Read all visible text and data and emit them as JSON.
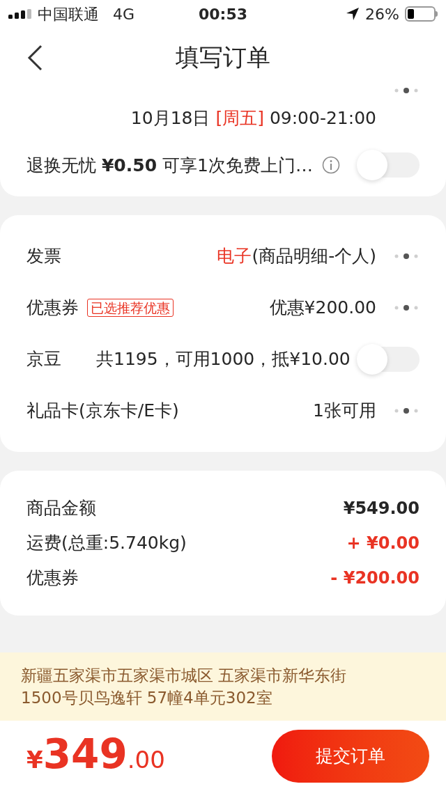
{
  "status_bar": {
    "carrier": "中国联通",
    "network": "4G",
    "time": "00:53",
    "battery": "26%"
  },
  "nav": {
    "title": "填写订单"
  },
  "delivery": {
    "date": "10月18日",
    "weekday": "[周五]",
    "time": "09:00-21:00"
  },
  "return_service": {
    "label": "退换无忧",
    "price": "¥0.50",
    "description": "可享1次免费上门…",
    "on": false
  },
  "options": [
    {
      "kind": "link",
      "label": "发票",
      "value_highlight": "电子",
      "value": "(商品明细-个人)"
    },
    {
      "kind": "link",
      "label": "优惠券",
      "tag": "已选推荐优惠",
      "value": "优惠¥200.00"
    },
    {
      "kind": "toggle",
      "label": "京豆",
      "detail": "共1195，可用1000，抵¥10.00",
      "on": false
    },
    {
      "kind": "link",
      "label": "礼品卡(京东卡/E卡)",
      "value": "1张可用"
    }
  ],
  "summary": [
    {
      "label": "商品金额",
      "value": "¥549.00",
      "color": "#262626"
    },
    {
      "label": "运费(总重:5.740kg)",
      "value": "+ ¥0.00",
      "color": "#e93323"
    },
    {
      "label": "优惠券",
      "value": "- ¥200.00",
      "color": "#e93323"
    }
  ],
  "address": {
    "lines": [
      "新疆五家渠市五家渠市城区 五家渠市新华东街",
      "1500号贝鸟逸轩 57幢4单元302室"
    ]
  },
  "footer": {
    "currency": "¥",
    "amount": "349",
    "decimals": ".00",
    "submit": "提交订单"
  }
}
